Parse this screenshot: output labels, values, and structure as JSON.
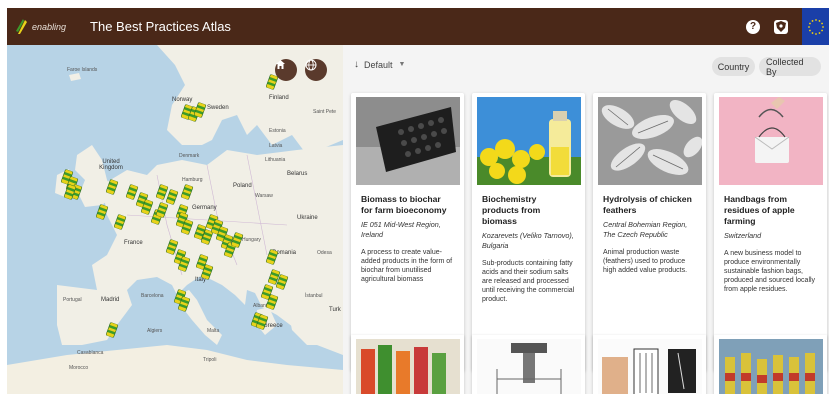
{
  "header": {
    "logo_text": "enabling",
    "title": "The Best Practices Atlas",
    "help_icon": "help-icon",
    "shield_icon": "shield-icon",
    "flag_icon": "eu-flag-icon"
  },
  "map": {
    "labels": {
      "faroe": "Faroe Islands",
      "norway": "Norway",
      "sweden": "Sweden",
      "finland": "Finland",
      "saint_petersburg": "Saint Pete",
      "estonia": "Estonia",
      "latvia": "Latvia",
      "denmark": "Denmark",
      "lithuania": "Lithuania",
      "united_kingdom": "United Kingdom",
      "hamburg": "Hamburg",
      "belarus": "Belarus",
      "warsaw": "Warsaw",
      "poland": "Poland",
      "germany": "Germany",
      "ukraine": "Ukraine",
      "france": "France",
      "hungary": "Hungary",
      "romania": "Romania",
      "italy": "Italy",
      "odesa": "Odesa",
      "portugal": "Portugal",
      "madrid": "Madrid",
      "barcelona": "Barcelona",
      "istanbul": "İstanbul",
      "turkey": "Turk",
      "algiers": "Algiers",
      "malta": "Malta",
      "casablanca": "Casablanca",
      "morocco": "Morocco",
      "tripoli": "Tripoli",
      "greece": "Greece",
      "albania": "Albania"
    },
    "home_icon": "home-icon",
    "globe_icon": "globe-icon"
  },
  "toolbar": {
    "sort_label": "Default",
    "chips": [
      "Country",
      "Collected By"
    ]
  },
  "cards": [
    {
      "title": "Biomass to biochar for farm bioeconomy",
      "location": "IE 051 Mid-West Region, Ireland",
      "description": "A process to create value-added products in the form of biochar from unutilised agricultural biomass"
    },
    {
      "title": "Biochemistry products from biomass",
      "location": "Kozarevets (Veliko Tarnovo), Bulgaria",
      "description": "Sub-products containing fatty acids and their sodium salts are released and processed until receiving the commercial product."
    },
    {
      "title": "Hydrolysis of chicken feathers",
      "location": "Central Bohemian Region, The Czech Republic",
      "description": "Animal production waste (feathers) used to produce high added value products."
    },
    {
      "title": "Handbags from residues of apple farming",
      "location": "Switzerland",
      "description": "A new business model to produce environmentally sustainable fashion bags, produced and sourced locally from apple residues."
    }
  ],
  "colors": {
    "header_bg": "#4a2818",
    "marker_green": "#3c9b2a",
    "marker_yellow": "#e8d21a",
    "eu_blue": "#1a3fa8"
  }
}
